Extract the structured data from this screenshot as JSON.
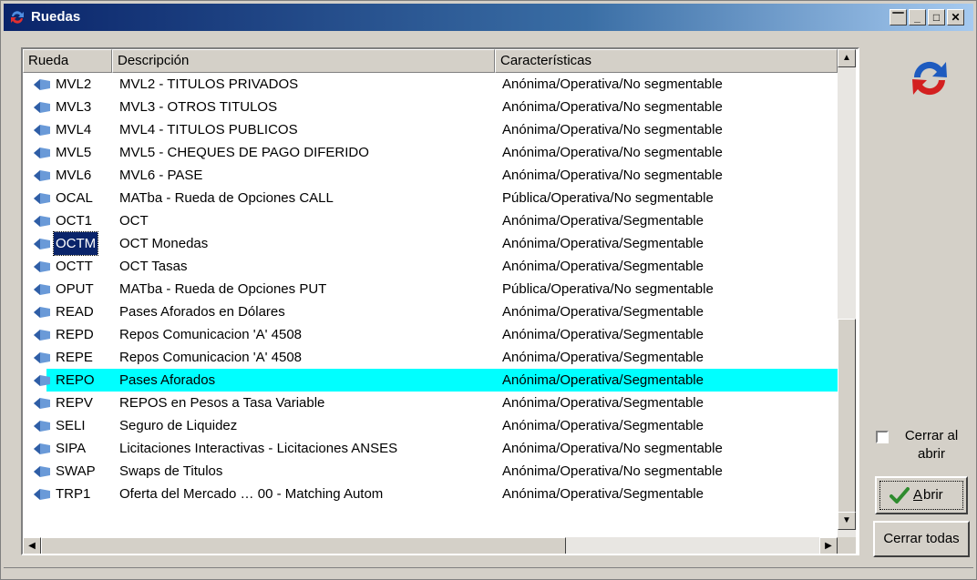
{
  "window": {
    "title": "Ruedas",
    "controls": [
      "restore",
      "minimize",
      "maximize",
      "close"
    ]
  },
  "table": {
    "columns": [
      "Rueda",
      "Descripción",
      "Características"
    ],
    "rows": [
      {
        "code": "MVL2",
        "desc": "MVL2 - TITULOS PRIVADOS",
        "chars": "Anónima/Operativa/No segmentable"
      },
      {
        "code": "MVL3",
        "desc": "MVL3 - OTROS TITULOS",
        "chars": "Anónima/Operativa/No segmentable"
      },
      {
        "code": "MVL4",
        "desc": "MVL4 - TITULOS PUBLICOS",
        "chars": "Anónima/Operativa/No segmentable"
      },
      {
        "code": "MVL5",
        "desc": "MVL5 - CHEQUES DE PAGO DIFERIDO",
        "chars": "Anónima/Operativa/No segmentable"
      },
      {
        "code": "MVL6",
        "desc": "MVL6 - PASE",
        "chars": "Anónima/Operativa/No segmentable"
      },
      {
        "code": "OCAL",
        "desc": "MATba - Rueda de Opciones CALL",
        "chars": "Pública/Operativa/No segmentable"
      },
      {
        "code": "OCT1",
        "desc": "OCT",
        "chars": "Anónima/Operativa/Segmentable"
      },
      {
        "code": "OCTM",
        "desc": "OCT Monedas",
        "chars": "Anónima/Operativa/Segmentable"
      },
      {
        "code": "OCTT",
        "desc": "OCT Tasas",
        "chars": "Anónima/Operativa/Segmentable"
      },
      {
        "code": "OPUT",
        "desc": "MATba - Rueda de Opciones PUT",
        "chars": "Pública/Operativa/No segmentable"
      },
      {
        "code": "READ",
        "desc": "Pases Aforados en Dólares",
        "chars": "Anónima/Operativa/Segmentable"
      },
      {
        "code": "REPD",
        "desc": "Repos Comunicacion 'A' 4508",
        "chars": "Anónima/Operativa/Segmentable"
      },
      {
        "code": "REPE",
        "desc": "Repos Comunicacion 'A' 4508",
        "chars": "Anónima/Operativa/Segmentable"
      },
      {
        "code": "REPO",
        "desc": "Pases Aforados",
        "chars": "Anónima/Operativa/Segmentable"
      },
      {
        "code": "REPV",
        "desc": "REPOS en Pesos a Tasa Variable",
        "chars": "Anónima/Operativa/Segmentable"
      },
      {
        "code": "SELI",
        "desc": "Seguro de Liquidez",
        "chars": "Anónima/Operativa/Segmentable"
      },
      {
        "code": "SIPA",
        "desc": "Licitaciones Interactivas - Licitaciones ANSES",
        "chars": "Anónima/Operativa/No segmentable"
      },
      {
        "code": "SWAP",
        "desc": "Swaps de Titulos",
        "chars": "Anónima/Operativa/No segmentable"
      },
      {
        "code": "TRP1",
        "desc": "Oferta del Mercado … 00 - Matching Autom",
        "chars": "Anónima/Operativa/Segmentable"
      }
    ],
    "selected_code": "OCTM",
    "highlighted_code": "REPO"
  },
  "side": {
    "cerrar_label_line1": "Cerrar al",
    "cerrar_label_line2": "abrir",
    "cerrar_checked": false,
    "abrir_label": "Abrir",
    "abrir_accel": "A",
    "cerrar_todas_label": "Cerrar todas"
  },
  "colors": {
    "title_bar_start": "#0a246a",
    "highlight_row": "#00ffff",
    "selection": "#0a246a",
    "face": "#d4d0c8",
    "logo_blue": "#1e5bbf",
    "logo_red": "#d32020"
  },
  "icons": {
    "window": "ruedas-app-icon",
    "row": "diamond-bullet-icon",
    "logo": "exchange-arrows-icon",
    "abrir": "checkmark-icon"
  }
}
